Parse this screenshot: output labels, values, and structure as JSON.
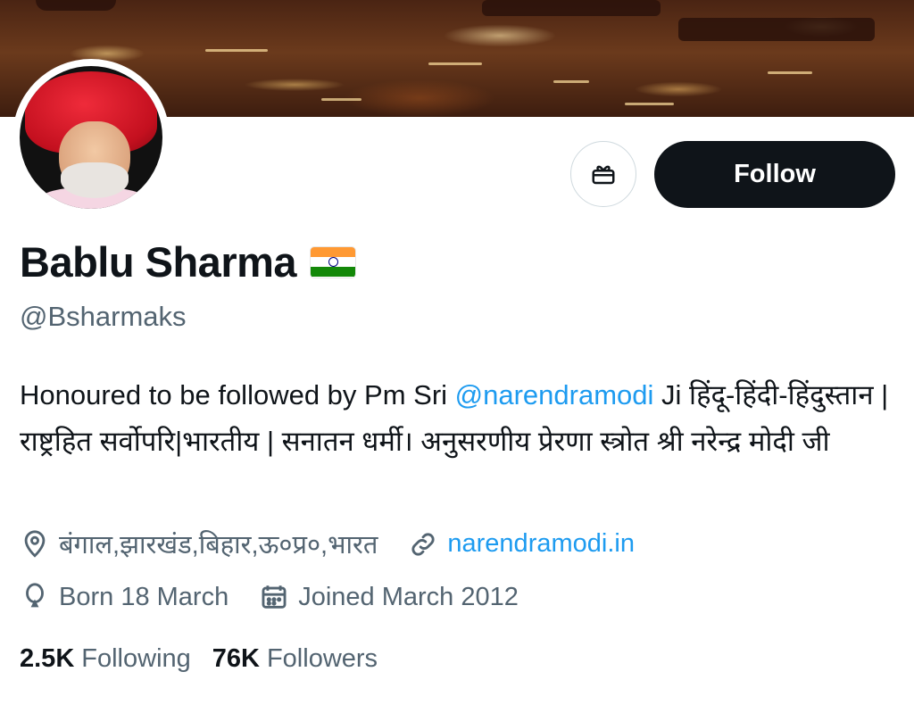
{
  "profile": {
    "name": "Bablu Sharma",
    "handle": "@Bsharmaks",
    "bio_prefix": "Honoured to be followed by Pm Sri ",
    "bio_mention": "@narendramodi",
    "bio_suffix": " Ji हिंदू-हिंदी-हिंदुस्तान |राष्ट्रहित सर्वोपरि|भारतीय | सनातन धर्मी। अनुसरणीय प्रेरणा स्त्रोत श्री नरेन्द्र मोदी जी",
    "location": "बंगाल,झारखंड,बिहार,ऊ०प्र०,भारत",
    "website": "narendramodi.in",
    "birthday": "Born 18 March",
    "joined": "Joined March 2012"
  },
  "actions": {
    "follow_label": "Follow",
    "gift_icon": "gift-icon"
  },
  "stats": {
    "following_count": "2.5K",
    "following_label": "Following",
    "followers_count": "76K",
    "followers_label": "Followers"
  },
  "colors": {
    "accent": "#1d9bf0",
    "button_dark": "#0f1419",
    "secondary_text": "#536471"
  }
}
